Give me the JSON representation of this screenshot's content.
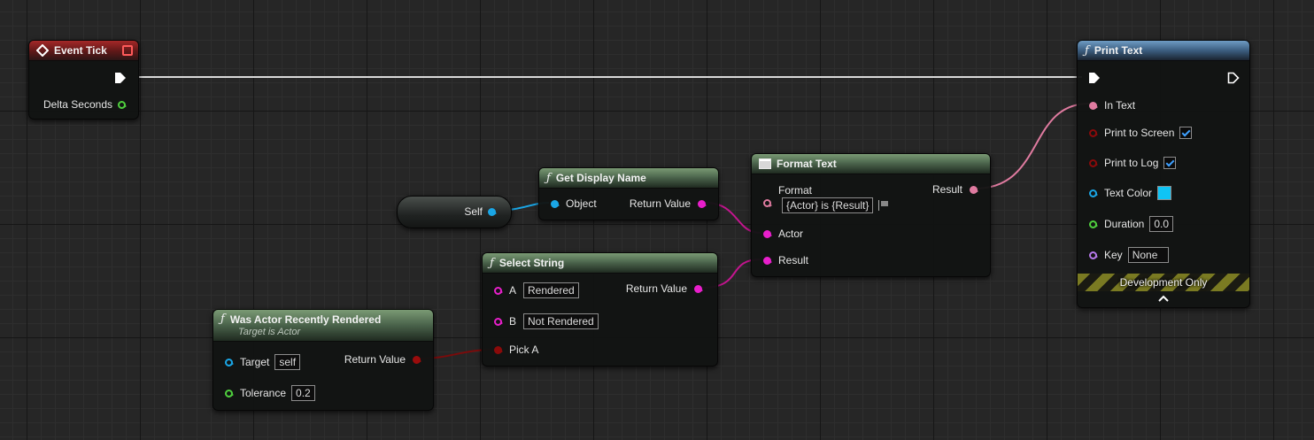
{
  "colors": {
    "exec": "#ffffff",
    "string_pin": "#e81fcb",
    "text_pin": "#e07ba0",
    "bool_pin": "#8a0a0a",
    "object_pin": "#1aa6e6",
    "float_pin": "#4fcf3e",
    "name_pin": "#b679ea",
    "text_color_swatch": "#0fc4f5",
    "development_stripe": "#7a7a22"
  },
  "event_tick": {
    "title": "Event Tick",
    "delta_seconds": "Delta Seconds"
  },
  "self_node": {
    "label": "Self"
  },
  "get_display_name": {
    "title": "Get Display Name",
    "object": "Object",
    "return_value": "Return Value"
  },
  "format_text": {
    "title": "Format Text",
    "format_label": "Format",
    "format_value": "{Actor} is {Result}",
    "result": "Result",
    "actor": "Actor",
    "result_in": "Result"
  },
  "select_string": {
    "title": "Select String",
    "a_label": "A",
    "a_value": "Rendered",
    "b_label": "B",
    "b_value": "Not Rendered",
    "pick_a": "Pick A",
    "return_value": "Return Value"
  },
  "was_rendered": {
    "title": "Was Actor Recently Rendered",
    "subtitle": "Target is Actor",
    "target": "Target",
    "target_value": "self",
    "tolerance": "Tolerance",
    "tolerance_value": "0.2",
    "return_value": "Return Value"
  },
  "print_text": {
    "title": "Print Text",
    "in_text": "In Text",
    "print_to_screen": "Print to Screen",
    "print_to_screen_checked": true,
    "print_to_log": "Print to Log",
    "print_to_log_checked": true,
    "text_color": "Text Color",
    "duration": "Duration",
    "duration_value": "0.0",
    "key": "Key",
    "key_value": "None",
    "dev_only": "Development Only"
  }
}
